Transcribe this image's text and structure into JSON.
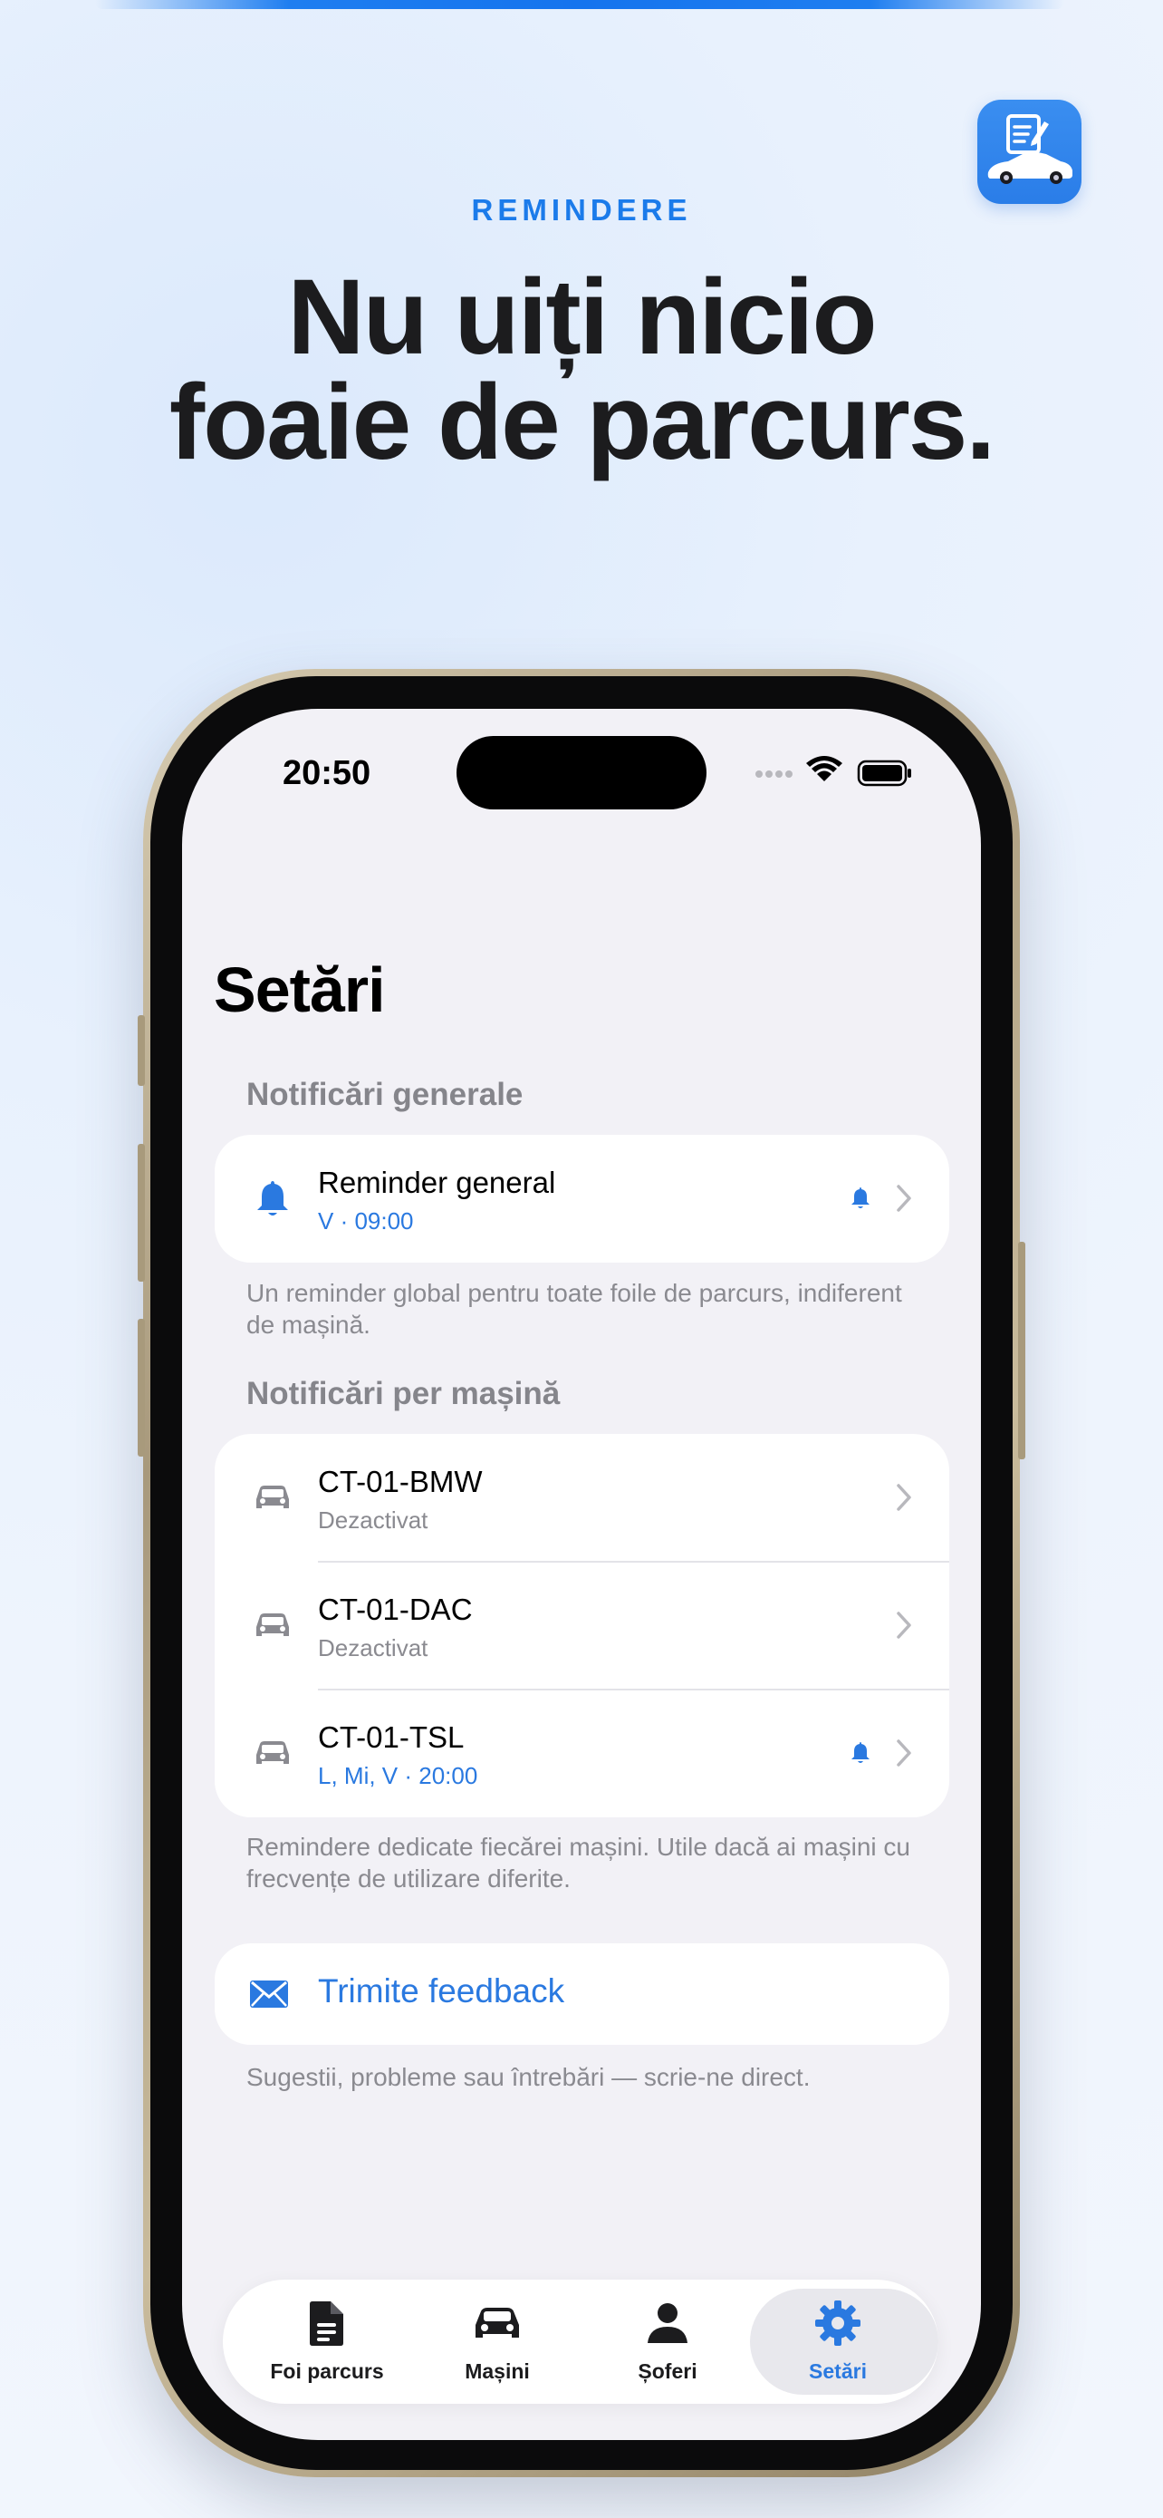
{
  "promo": {
    "eyebrow": "REMINDERE",
    "headline_line1": "Nu uiți nicio",
    "headline_line2": "foaie de parcurs."
  },
  "app_icon": {
    "name": "app-icon"
  },
  "status_bar": {
    "time": "20:50"
  },
  "screen": {
    "title": "Setări",
    "general": {
      "header": "Notificări generale",
      "row": {
        "title": "Reminder general",
        "subtitle": "V · 09:00",
        "enabled": true
      },
      "footnote": "Un reminder global pentru toate foile de parcurs, indiferent de mașină."
    },
    "per_car": {
      "header": "Notificări per mașină",
      "rows": [
        {
          "title": "CT-01-BMW",
          "subtitle": "Dezactivat",
          "enabled": false
        },
        {
          "title": "CT-01-DAC",
          "subtitle": "Dezactivat",
          "enabled": false
        },
        {
          "title": "CT-01-TSL",
          "subtitle": "L, Mi, V · 20:00",
          "enabled": true
        }
      ],
      "footnote": "Remindere dedicate fiecărei mașini. Utile dacă ai mașini cu frecvențe de utilizare diferite."
    },
    "feedback": {
      "label": "Trimite feedback",
      "footnote": "Sugestii, probleme sau întrebări — scrie-ne direct."
    }
  },
  "tabbar": {
    "tabs": [
      {
        "label": "Foi parcurs",
        "icon": "document-icon"
      },
      {
        "label": "Mașini",
        "icon": "car-icon"
      },
      {
        "label": "Șoferi",
        "icon": "person-icon"
      },
      {
        "label": "Setări",
        "icon": "gear-icon",
        "active": true
      }
    ]
  },
  "colors": {
    "accent": "#2a79e0",
    "secondary_text": "#8a8a90",
    "background": "#f2f1f6"
  }
}
